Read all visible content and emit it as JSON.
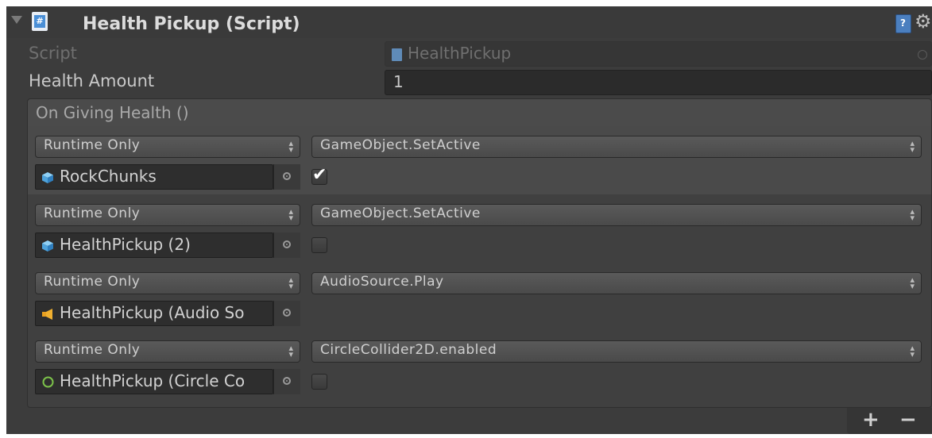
{
  "component": {
    "title": "Health Pickup (Script)",
    "script_label": "Script",
    "script_value": "HealthPickup",
    "health_label": "Health Amount",
    "health_value": "1"
  },
  "event": {
    "header": "On Giving Health ()",
    "entries": [
      {
        "mode": "Runtime Only",
        "function": "GameObject.SetActive",
        "target": "RockChunks",
        "icon": "gameobject-cube-icon",
        "has_checkbox": true,
        "checked": true
      },
      {
        "mode": "Runtime Only",
        "function": "GameObject.SetActive",
        "target": "HealthPickup (2)",
        "icon": "gameobject-cube-icon",
        "has_checkbox": true,
        "checked": false
      },
      {
        "mode": "Runtime Only",
        "function": "AudioSource.Play",
        "target": "HealthPickup (Audio So",
        "icon": "audio-source-icon",
        "has_checkbox": false,
        "checked": false
      },
      {
        "mode": "Runtime Only",
        "function": "CircleCollider2D.enabled",
        "target": "HealthPickup (Circle Co",
        "icon": "circle-collider-icon",
        "has_checkbox": true,
        "checked": false
      }
    ],
    "add_label": "+",
    "remove_label": "−"
  },
  "colors": {
    "panel_bg": "#3c3c3c",
    "event_bg": "#404040",
    "field_bg": "#2b2b2b",
    "script_icon": "#4a8fd6",
    "cube_icon": "#55a8e0",
    "audio_icon": "#e8a020",
    "collider_icon": "#7cc24a"
  }
}
